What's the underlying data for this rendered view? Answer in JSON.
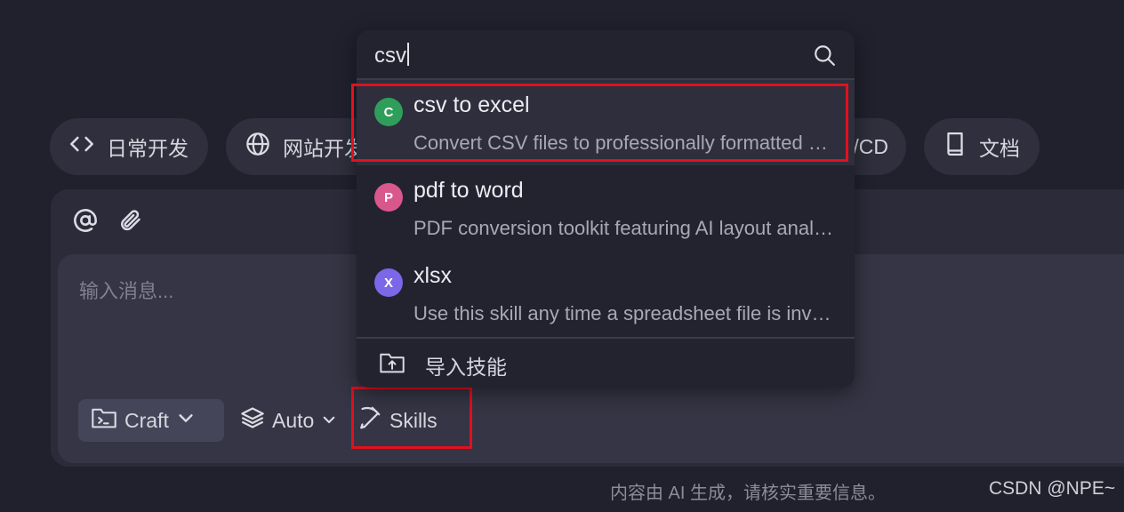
{
  "chips": [
    {
      "label": "日常开发",
      "icon": "code-icon"
    },
    {
      "label": "网站开发",
      "icon": "globe-icon"
    },
    {
      "label": "CI/CD",
      "icon": "workflow-icon"
    },
    {
      "label": "文档",
      "icon": "book-icon"
    }
  ],
  "composer": {
    "placeholder": "输入消息...",
    "craft_label": "Craft",
    "auto_label": "Auto",
    "skills_label": "Skills"
  },
  "footer_note": "内容由 AI 生成，请核实重要信息。",
  "watermark": "CSDN @NPE~",
  "skills_dropdown": {
    "query": "csv",
    "items": [
      {
        "badge": "C",
        "badge_color": "#2f9e5b",
        "title": "csv to excel",
        "description": "Convert CSV files to professionally formatted Excel workbooks"
      },
      {
        "badge": "P",
        "badge_color": "#d9588c",
        "title": "pdf to word",
        "description": "PDF conversion toolkit featuring AI layout analysis"
      },
      {
        "badge": "X",
        "badge_color": "#7b67e8",
        "title": "xlsx",
        "description": "Use this skill any time a spreadsheet file is involved"
      }
    ],
    "import_label": "导入技能"
  },
  "colors": {
    "highlight_box": "#e3101d",
    "background": "#21212e"
  }
}
